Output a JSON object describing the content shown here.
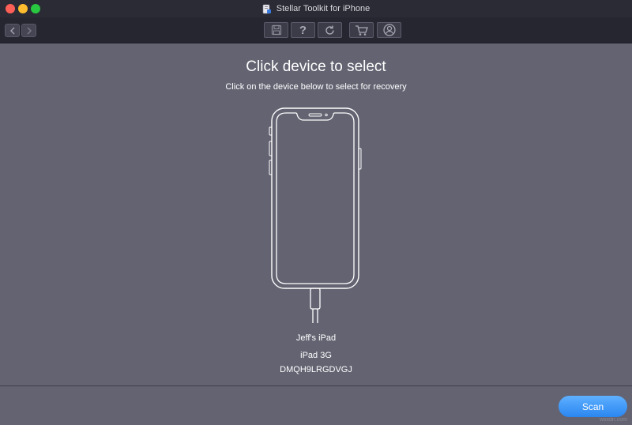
{
  "window": {
    "title": "Stellar Toolkit for iPhone"
  },
  "toolbar": {
    "nav": [
      "back-icon",
      "forward-icon"
    ],
    "buttons": [
      "save-icon",
      "help-icon",
      "refresh-icon",
      "cart-icon",
      "user-icon"
    ],
    "help_glyph": "?"
  },
  "main": {
    "title": "Click device to select",
    "subtitle": "Click on the device below to select for recovery"
  },
  "device": {
    "name": "Jeff's iPad",
    "model": "iPad 3G",
    "serial": "DMQH9LRGDVGJ"
  },
  "footer": {
    "scan_label": "Scan"
  },
  "watermark": "wsxdn.com",
  "colors": {
    "background": "#636372",
    "titlebar": "#2b2b35",
    "toolbar": "#262631",
    "accent": "#2a86f0"
  }
}
